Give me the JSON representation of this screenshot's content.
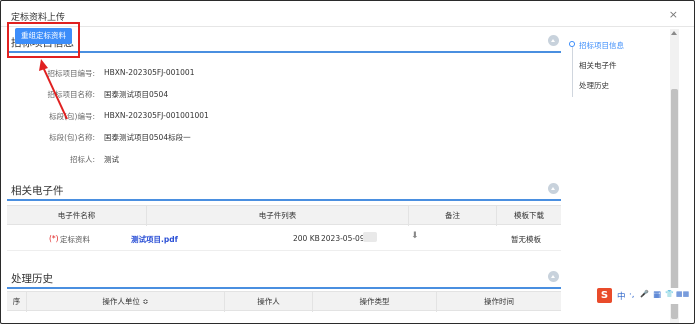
{
  "window": {
    "title": "定标资料上传",
    "close": "×"
  },
  "toolbar": {
    "reselect_label": "重组定标资料"
  },
  "sections": {
    "project_info": "招标项目信息",
    "attachments": "相关电子件",
    "history": "处理历史"
  },
  "project_info": [
    {
      "key": "招标项目编号:",
      "value": "HBXN-202305FJ-001001"
    },
    {
      "key": "招标项目名称:",
      "value": "国泰测试项目0504"
    },
    {
      "key": "标段(包)编号:",
      "value": "HBXN-202305FJ-001001001"
    },
    {
      "key": "标段(包)名称:",
      "value": "国泰测试项目0504标段一"
    },
    {
      "key": "招标人:",
      "value": "测试"
    }
  ],
  "attachments_table": {
    "headers": [
      "电子件名称",
      "电子件列表",
      "备注",
      "模板下载"
    ],
    "rows": [
      {
        "required_mark": "(*)",
        "name": "定标资料",
        "file": "测试项目.pdf",
        "size": "200 KB",
        "date": "2023-05-09",
        "template": "暂无模板"
      }
    ]
  },
  "history_table": {
    "headers": [
      "序",
      "操作人单位 ≎",
      "操作人",
      "操作类型",
      "操作时间"
    ]
  },
  "sidenav": [
    "招标项目信息",
    "相关电子件",
    "处理历史"
  ],
  "ime": {
    "logo": "S",
    "items": [
      "中",
      "·,",
      "🎤",
      "▦",
      "👕",
      "▦▦"
    ]
  },
  "colors": {
    "accent": "#3c8dfa",
    "highlight_red": "#e02020",
    "section_line": "#4a8fe0"
  }
}
